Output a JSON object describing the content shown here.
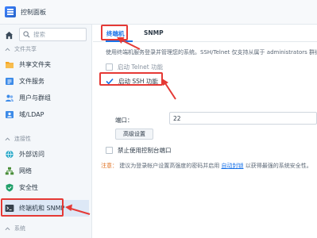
{
  "window": {
    "title": "控制面板"
  },
  "sidebar": {
    "search_placeholder": "搜索",
    "sections": {
      "file_sharing": "文件共享",
      "connectivity": "连接性",
      "system": "系统"
    },
    "items": [
      {
        "label": "共享文件夹",
        "icon": "folder-share-icon"
      },
      {
        "label": "文件服务",
        "icon": "file-services-icon"
      },
      {
        "label": "用户与群组",
        "icon": "users-icon"
      },
      {
        "label": "域/LDAP",
        "icon": "ldap-icon"
      },
      {
        "label": "外部访问",
        "icon": "external-access-icon"
      },
      {
        "label": "网络",
        "icon": "network-icon"
      },
      {
        "label": "安全性",
        "icon": "shield-icon"
      },
      {
        "label": "终端机和 SNMP",
        "icon": "terminal-icon"
      }
    ]
  },
  "tabs": [
    "终端机",
    "SNMP"
  ],
  "main": {
    "description": "使用终端机服务登录并管理您的系统。SSH/Telnet 仅支持从属于 administrators 群组的用户登录。",
    "telnet_label": "启动 Telnet 功能",
    "ssh_label": "启动 SSH 功能",
    "port_label": "端口：",
    "port_value": "22",
    "advanced_button": "高级设置",
    "console_label": "禁止使用控制台端口",
    "note_label": "注意：",
    "note_text": "建议为登录帐户设置高强度的密码并启用",
    "note_link": "自动封锁",
    "note_suffix": "以获得最强的系统安全性。"
  },
  "colors": {
    "accent": "#1a73e8",
    "highlight": "#e53935",
    "active_bg": "#dde8f6"
  }
}
